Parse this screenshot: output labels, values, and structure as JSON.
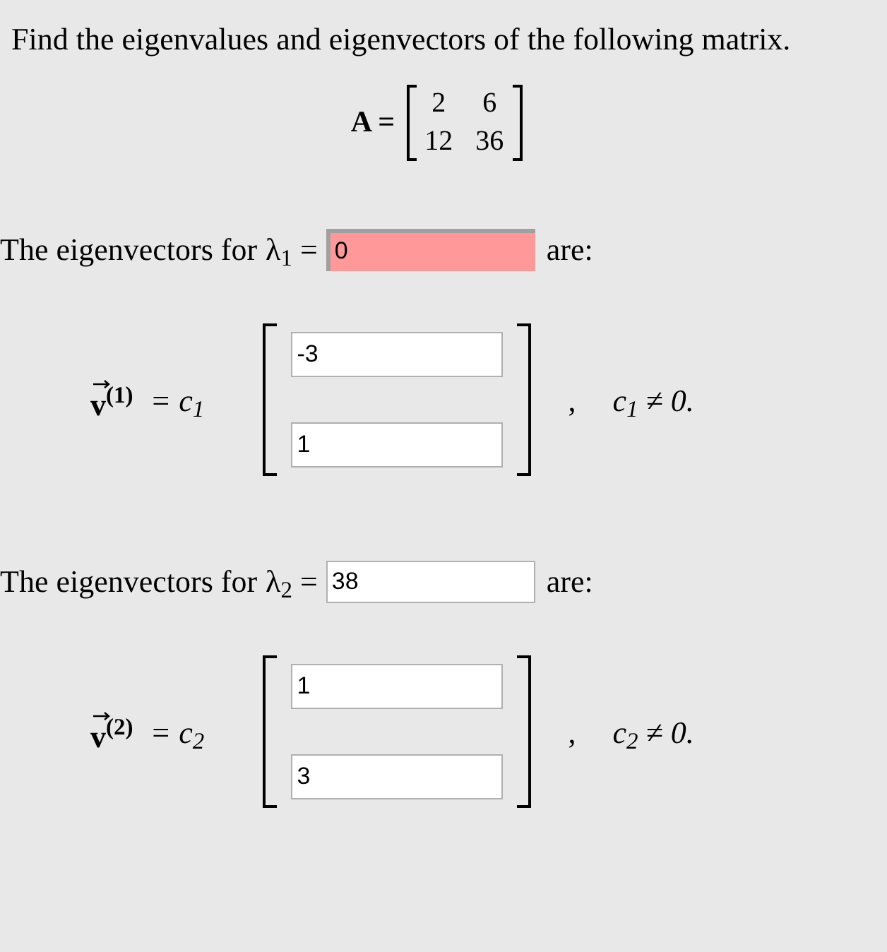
{
  "question": "Find the eigenvalues and eigenvectors of the following matrix.",
  "matrix": {
    "label": "A =",
    "rows": [
      [
        "2",
        "6"
      ],
      [
        "12",
        "36"
      ]
    ]
  },
  "eigen": [
    {
      "prompt": "The eigenvectors for",
      "symbol": "λ$_{1}$ =",
      "value": "0",
      "marked_incorrect": true,
      "suffix": "are:",
      "vector_label": "v$^{(1)}$",
      "coefficient": "= c$_{1}$",
      "entries": [
        "-3",
        "1"
      ],
      "separator": ",",
      "condition": "c$_{1}$ ≠ 0."
    },
    {
      "prompt": "The eigenvectors for",
      "symbol": "λ$_{2}$ =",
      "value": "38",
      "marked_incorrect": false,
      "suffix": "are:",
      "vector_label": "v$^{(2)}$",
      "coefficient": "= c$_{2}$",
      "entries": [
        "1",
        "3"
      ],
      "separator": ",",
      "condition": "c$_{2}$ ≠ 0."
    }
  ]
}
